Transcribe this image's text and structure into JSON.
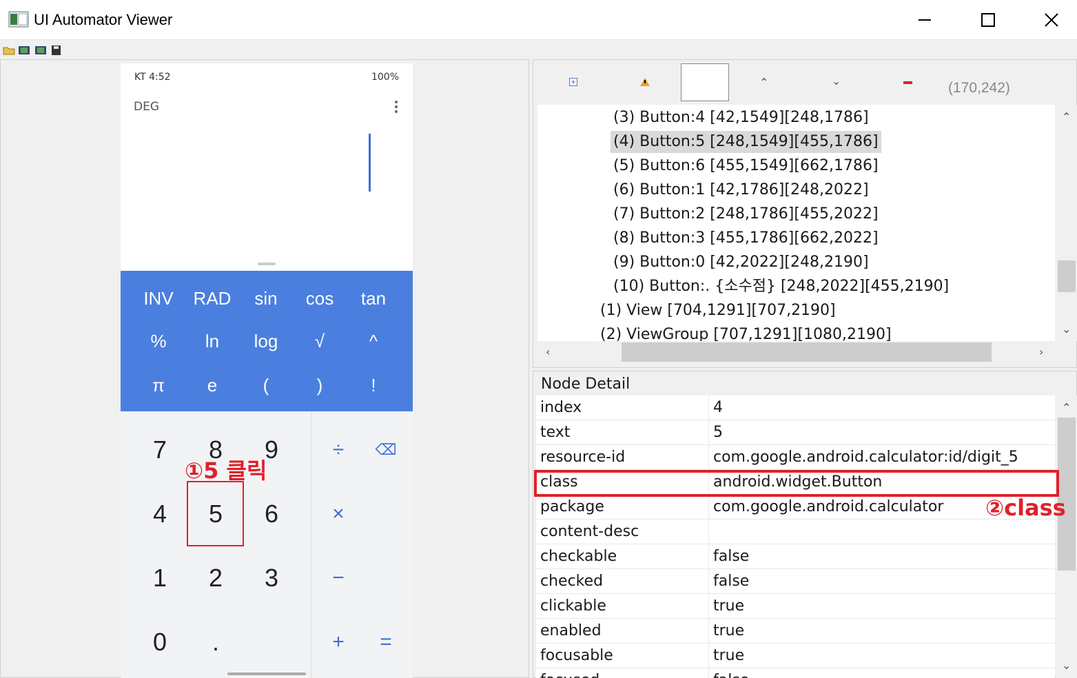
{
  "window": {
    "title": "UI Automator Viewer",
    "minimize": "—",
    "maximize": "☐",
    "close": "✕"
  },
  "toolbar": {
    "icons": [
      "open-icon",
      "device-screenshot-icon",
      "device-screenshot-compressed-icon",
      "save-icon"
    ]
  },
  "phone": {
    "status_left": "KT 4:52",
    "status_right": "100%",
    "mode": "DEG",
    "sci_rows": [
      [
        "INV",
        "RAD",
        "sin",
        "cos",
        "tan"
      ],
      [
        "%",
        "ln",
        "log",
        "√",
        "^"
      ],
      [
        "π",
        "e",
        "(",
        ")",
        "!"
      ]
    ],
    "digits": [
      [
        "7",
        "8",
        "9"
      ],
      [
        "4",
        "5",
        "6"
      ],
      [
        "1",
        "2",
        "3"
      ],
      [
        "0",
        "."
      ]
    ],
    "ops": [
      "÷",
      "×",
      "−",
      "+"
    ],
    "backspace": "⌫",
    "equals": "="
  },
  "annotations": {
    "step1": "①5 클릭",
    "step2": "②class",
    "highlight_color": "#e0202a"
  },
  "tree": {
    "coord": "(170,242)",
    "rows": [
      {
        "label": "(3) Button:4 [42,1549][248,1786]",
        "indent": 1,
        "selected": false
      },
      {
        "label": "(4) Button:5 [248,1549][455,1786]",
        "indent": 1,
        "selected": true
      },
      {
        "label": "(5) Button:6 [455,1549][662,1786]",
        "indent": 1,
        "selected": false
      },
      {
        "label": "(6) Button:1 [42,1786][248,2022]",
        "indent": 1,
        "selected": false
      },
      {
        "label": "(7) Button:2 [248,1786][455,2022]",
        "indent": 1,
        "selected": false
      },
      {
        "label": "(8) Button:3 [455,1786][662,2022]",
        "indent": 1,
        "selected": false
      },
      {
        "label": "(9) Button:0 [42,2022][248,2190]",
        "indent": 1,
        "selected": false
      },
      {
        "label": "(10) Button:. {소수점} [248,2022][455,2190]",
        "indent": 1,
        "selected": false
      },
      {
        "label": "(1) View [704,1291][707,2190]",
        "indent": 0,
        "selected": false
      },
      {
        "label": "(2) ViewGroup [707,1291][1080,2190]",
        "indent": 0,
        "selected": false
      }
    ]
  },
  "node_detail": {
    "title": "Node Detail",
    "rows": [
      {
        "key": "index",
        "value": "4"
      },
      {
        "key": "text",
        "value": "5"
      },
      {
        "key": "resource-id",
        "value": "com.google.android.calculator:id/digit_5"
      },
      {
        "key": "class",
        "value": "android.widget.Button"
      },
      {
        "key": "package",
        "value": "com.google.android.calculator"
      },
      {
        "key": "content-desc",
        "value": ""
      },
      {
        "key": "checkable",
        "value": "false"
      },
      {
        "key": "checked",
        "value": "false"
      },
      {
        "key": "clickable",
        "value": "true"
      },
      {
        "key": "enabled",
        "value": "true"
      },
      {
        "key": "focusable",
        "value": "true"
      },
      {
        "key": "focused",
        "value": "false"
      }
    ]
  }
}
